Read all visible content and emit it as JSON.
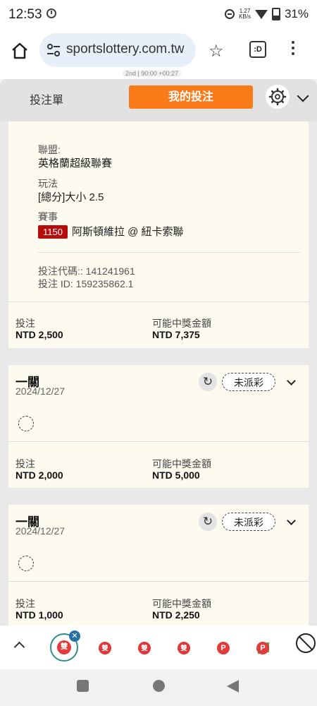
{
  "status_bar": {
    "time": "12:53",
    "net_speed_value": "1.27",
    "net_speed_unit": "KB/s",
    "battery": "31%"
  },
  "browser": {
    "url": "sportslottery.com.tw"
  },
  "peek": {
    "text": "2nd | 90:00 +00:27"
  },
  "header": {
    "tabs": [
      "投注單",
      "我的投注"
    ],
    "active_tab": "我的投注"
  },
  "expanded_bet": {
    "league_label": "聯盟:",
    "league_value": "英格蘭超級聯賽",
    "play_label": "玩法",
    "play_value": "[總分]大小 2.5",
    "event_label": "賽事",
    "event_badge": "1150",
    "event_value": "阿斯頓維拉 @ 紐卡索聯",
    "bet_code": "投注代碼:: 141241961",
    "bet_id": "投注 ID: 159235862.1",
    "stake_label": "投注",
    "stake_value": "NTD 2,500",
    "payout_label": "可能中獎金額",
    "payout_value": "NTD 7,375"
  },
  "bets": [
    {
      "type": "一關",
      "date": "2024/12/27",
      "status": "未派彩",
      "stake_label": "投注",
      "stake_value": "NTD 2,000",
      "payout_label": "可能中獎金額",
      "payout_value": "NTD 5,000"
    },
    {
      "type": "一關",
      "date": "2024/12/27",
      "status": "未派彩",
      "stake_label": "投注",
      "stake_value": "NTD 1,000",
      "payout_label": "可能中獎金額",
      "payout_value": "NTD 2,250"
    }
  ],
  "bottom_toolbar": {
    "active_tab_badge": "雙",
    "tab_badges": [
      "雙",
      "雙",
      "雙",
      "P",
      "P"
    ]
  },
  "icons": {
    "accent": "#fb7b1a",
    "event_badge_color": "#b50c0c"
  }
}
